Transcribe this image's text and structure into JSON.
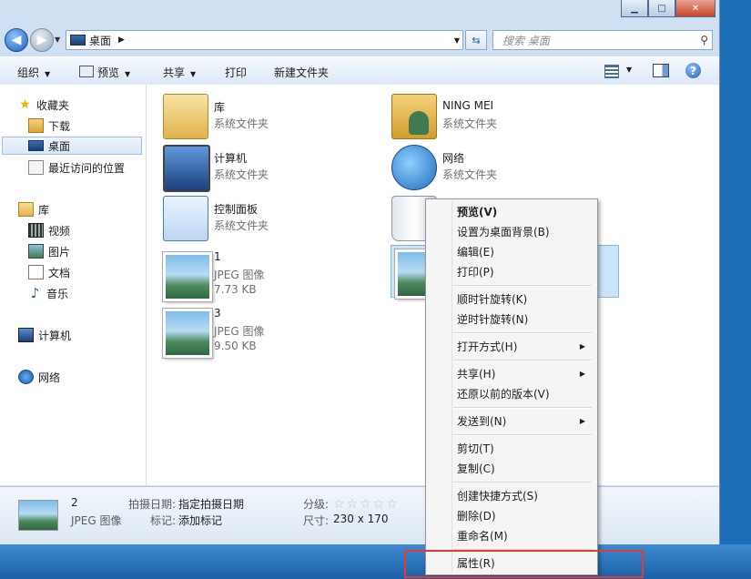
{
  "address": {
    "location": "桌面",
    "search_placeholder": "搜索 桌面"
  },
  "toolbar": {
    "organize": "组织",
    "preview": "预览",
    "share": "共享",
    "print": "打印",
    "new_folder": "新建文件夹"
  },
  "nav": {
    "favorites": "收藏夹",
    "downloads": "下载",
    "desktop": "桌面",
    "recent": "最近访问的位置",
    "libraries": "库",
    "videos": "视频",
    "pictures": "图片",
    "documents": "文档",
    "music": "音乐",
    "computer": "计算机",
    "network": "网络"
  },
  "items": [
    {
      "name": "库",
      "type": "系统文件夹"
    },
    {
      "name": "NING MEI",
      "type": "系统文件夹"
    },
    {
      "name": "计算机",
      "type": "系统文件夹"
    },
    {
      "name": "网络",
      "type": "系统文件夹"
    },
    {
      "name": "控制面板",
      "type": "系统文件夹"
    },
    {
      "name": "1",
      "type": "JPEG 图像",
      "size": "7.73 KB"
    },
    {
      "name": "3",
      "type": "JPEG 图像",
      "size": "9.50 KB"
    }
  ],
  "details": {
    "name": "2",
    "type": "JPEG 图像",
    "date_label": "拍摄日期:",
    "date_value": "指定拍摄日期",
    "tags_label": "标记:",
    "tags_value": "添加标记",
    "rating_label": "分级:",
    "rating": 0,
    "size_label": "尺寸:",
    "size_value": "230 x 170"
  },
  "menu": [
    {
      "label": "预览(V)",
      "bold": true
    },
    {
      "label": "设置为桌面背景(B)"
    },
    {
      "label": "编辑(E)"
    },
    {
      "label": "打印(P)"
    },
    {
      "label": "顺时针旋转(K)"
    },
    {
      "label": "逆时针旋转(N)"
    },
    {
      "label": "打开方式(H)",
      "submenu": true
    },
    {
      "label": "共享(H)",
      "submenu": true
    },
    {
      "label": "还原以前的版本(V)"
    },
    {
      "label": "发送到(N)",
      "submenu": true
    },
    {
      "label": "剪切(T)"
    },
    {
      "label": "复制(C)"
    },
    {
      "label": "创建快捷方式(S)"
    },
    {
      "label": "删除(D)"
    },
    {
      "label": "重命名(M)"
    },
    {
      "label": "属性(R)"
    }
  ],
  "icons": {
    "search": "search-icon",
    "refresh": "refresh-icon",
    "help": "help-icon"
  },
  "colors": {
    "highlight": "#e53935",
    "selection": "#cce4fb"
  }
}
